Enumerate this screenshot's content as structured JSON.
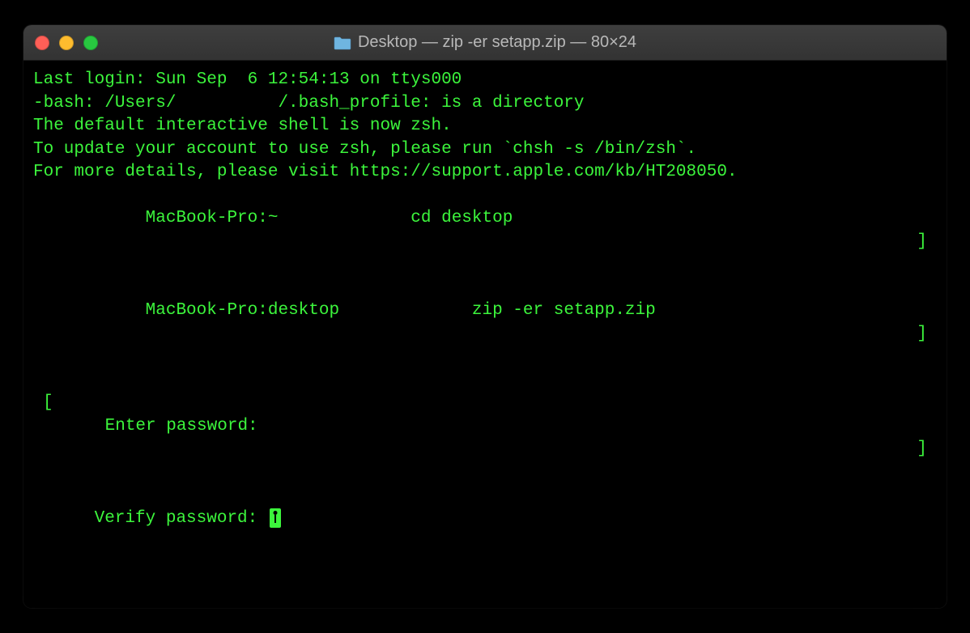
{
  "window": {
    "title": "Desktop — zip -er setapp.zip — 80×24"
  },
  "terminal": {
    "lines": {
      "last_login": "Last login: Sun Sep  6 12:54:13 on ttys000",
      "bash_error": "-bash: /Users/          /.bash_profile: is a directory",
      "blank": "",
      "zsh_notice1": "The default interactive shell is now zsh.",
      "zsh_notice2": "To update your account to use zsh, please run `chsh -s /bin/zsh`.",
      "zsh_notice3": "For more details, please visit https://support.apple.com/kb/HT208050.",
      "prompt1": "     MacBook-Pro:~             cd desktop",
      "prompt2": "     MacBook-Pro:desktop             zip -er setapp.zip",
      "enter_pw": "Enter password: ",
      "verify_pw": "Verify password: ",
      "bracket_right": "]",
      "bracket_left": "["
    }
  }
}
